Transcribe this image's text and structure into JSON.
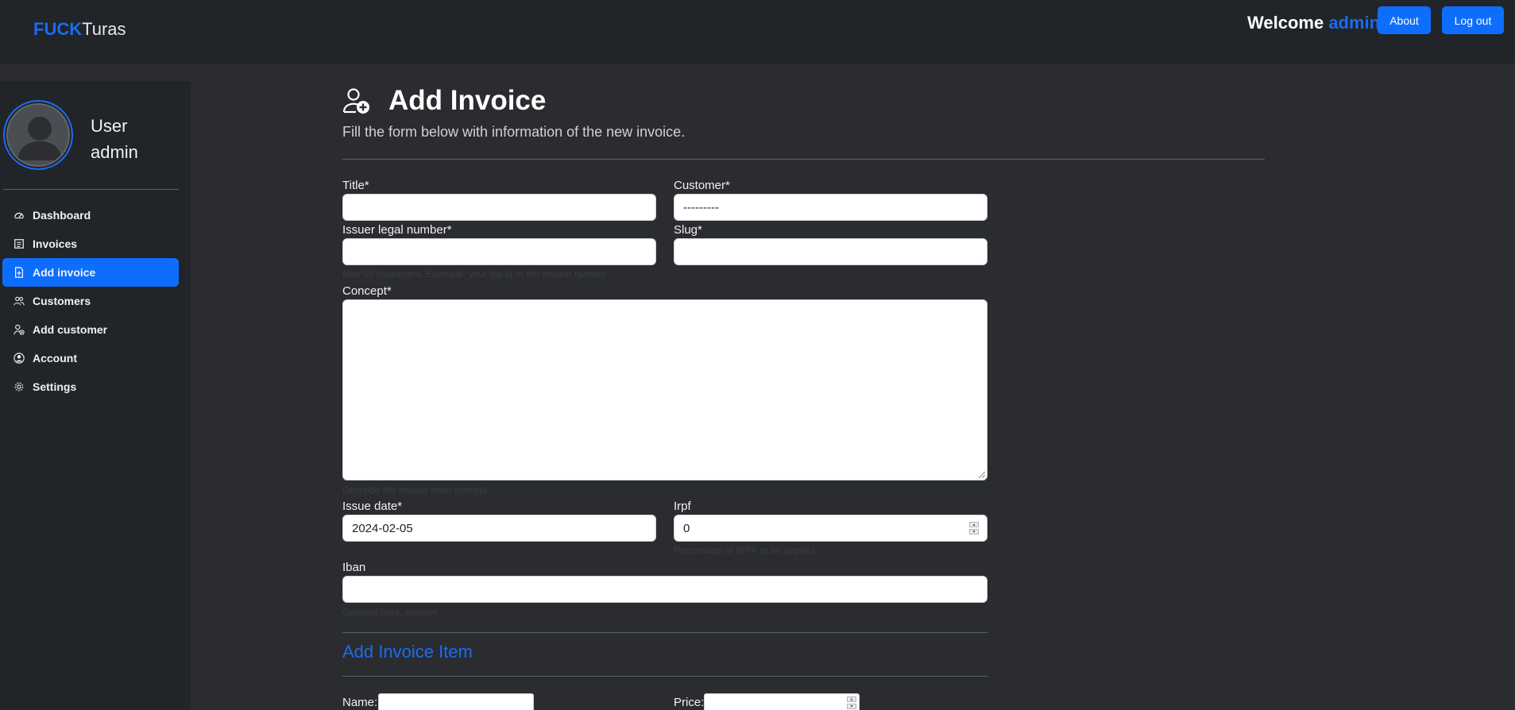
{
  "navbar": {
    "brand_part1": "FUCK",
    "brand_part2": "Turas",
    "welcome_text": "Welcome",
    "welcome_user": "admin",
    "about_label": "About",
    "logout_label": "Log out"
  },
  "sidebar": {
    "user_line1": "User",
    "user_line2": "admin",
    "items": [
      {
        "label": "Dashboard",
        "icon": "speedometer-icon",
        "active": false
      },
      {
        "label": "Invoices",
        "icon": "list-icon",
        "active": false
      },
      {
        "label": "Add invoice",
        "icon": "file-plus-icon",
        "active": true
      },
      {
        "label": "Customers",
        "icon": "people-icon",
        "active": false
      },
      {
        "label": "Add customer",
        "icon": "person-add-icon",
        "active": false
      },
      {
        "label": "Account",
        "icon": "person-circle-icon",
        "active": false
      },
      {
        "label": "Settings",
        "icon": "gear-icon",
        "active": false
      }
    ]
  },
  "main": {
    "title": "Add Invoice",
    "subtitle": "Fill the form below with information of the new invoice.",
    "form": {
      "title_label": "Title*",
      "title_value": "",
      "customer_label": "Customer*",
      "customer_value": "---------",
      "issuer_label": "Issuer legal number*",
      "issuer_value": "",
      "issuer_hint": "Max 50 characters. Example: your tax id or the invoice number",
      "slug_label": "Slug*",
      "slug_value": "",
      "concept_label": "Concept*",
      "concept_value": "",
      "concept_hint": "Describe the invoice main concept",
      "issue_date_label": "Issue date*",
      "issue_date_value": "2024-02-05",
      "irpf_label": "Irpf",
      "irpf_value": "0",
      "irpf_hint": "Percentage of IRPF to be applied",
      "iban_label": "Iban",
      "iban_value": "",
      "iban_hint": "Optional bank account"
    },
    "item_section_title": "Add Invoice Item",
    "item_name_label": "Name:",
    "item_price_label": "Price:"
  },
  "colors": {
    "accent": "#0d6efd",
    "brand_blue": "#1a6cf0",
    "navbar_bg": "#212429",
    "page_bg": "#2b2c30"
  }
}
